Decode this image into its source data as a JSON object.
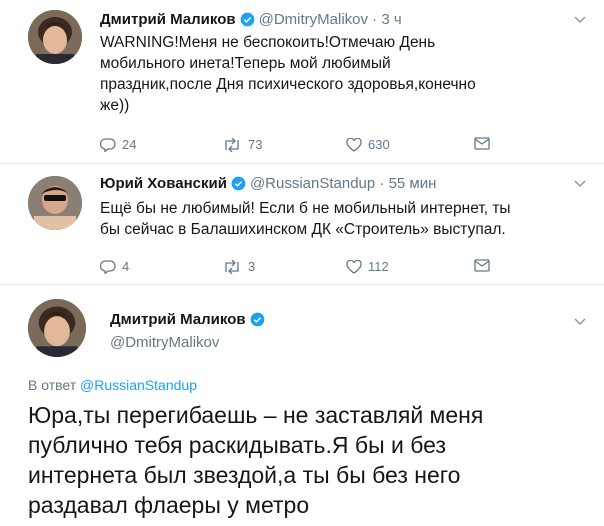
{
  "tweets": [
    {
      "name": "Дмитрий Маликов",
      "handle": "@DmitryMalikov · 3 ч",
      "text_lines": [
        "WARNING!Меня не беспокоить!Отмечаю День",
        "мобильного инета!Теперь мой любимый",
        "праздник,после Дня психического здоровья,конечно",
        "же))"
      ],
      "replies": "24",
      "retweets": "73",
      "likes": "630"
    },
    {
      "name": "Юрий Хованский",
      "handle": "@RussianStandup · 55 мин",
      "text_lines": [
        "Ещё бы не любимый! Если б не мобильный интернет, ты",
        "бы сейчас в Балашихинском ДК «Строитель» выступал."
      ],
      "replies": "4",
      "retweets": "3",
      "likes": "112"
    }
  ],
  "main_tweet": {
    "name": "Дмитрий Маликов",
    "handle": "@DmitryMalikov",
    "reply_prefix": "В ответ",
    "reply_handle": "@RussianStandup",
    "text_lines": [
      "Юра,ты перегибаешь – не заставляй меня",
      "публично тебя раскидывать.Я бы и без",
      "интернета был звездой,а ты бы без него",
      "раздавал флаеры у метро"
    ]
  },
  "colors": {
    "accent": "#1da1f2",
    "text": "#14171a",
    "muted": "#657786",
    "divider": "#e6ecf0"
  },
  "icons": [
    "reply-icon",
    "retweet-icon",
    "like-icon",
    "dm-icon",
    "verified-icon",
    "chevron-down-icon"
  ]
}
